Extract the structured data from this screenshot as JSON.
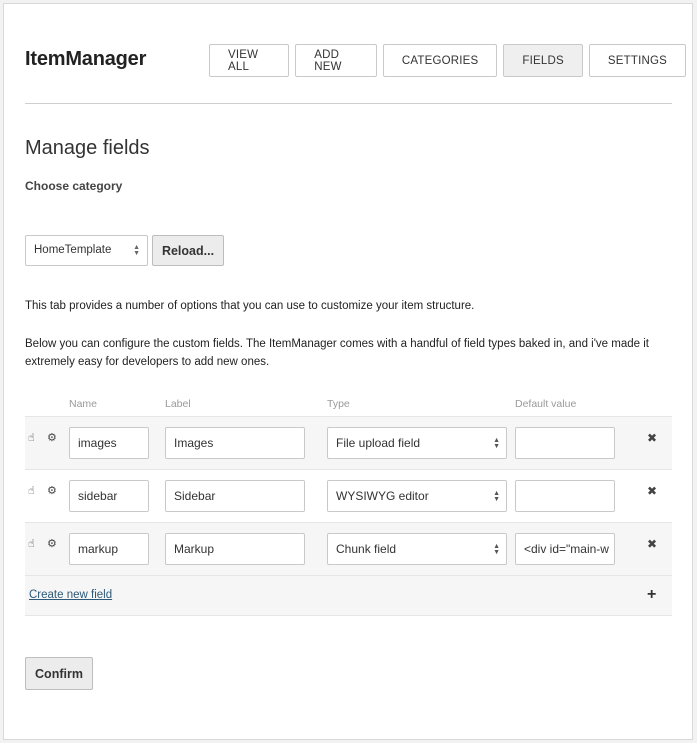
{
  "header": {
    "brand": "ItemManager",
    "nav": [
      {
        "label": "VIEW ALL",
        "active": false
      },
      {
        "label": "ADD NEW",
        "active": false
      },
      {
        "label": "CATEGORIES",
        "active": false
      },
      {
        "label": "FIELDS",
        "active": true
      },
      {
        "label": "SETTINGS",
        "active": false
      }
    ]
  },
  "main": {
    "title": "Manage fields",
    "choose_category_label": "Choose category",
    "category_select_value": "HomeTemplate",
    "reload_label": "Reload...",
    "intro_text": "This tab provides a number of options that you can use to customize your item structure.",
    "config_text": "Below you can configure the custom fields. The ItemManager comes with a handful of field types baked in, and i've made it extremely easy for developers to add new ones.",
    "columns": [
      "Name",
      "Label",
      "Type",
      "Default value"
    ],
    "fields": [
      {
        "name": "images",
        "label": "Images",
        "type": "File upload field",
        "default": ""
      },
      {
        "name": "sidebar",
        "label": "Sidebar",
        "type": "WYSIWYG editor",
        "default": ""
      },
      {
        "name": "markup",
        "label": "Markup",
        "type": "Chunk field",
        "default": "<div id=\"main-w"
      }
    ],
    "create_new_field_label": "Create new field",
    "confirm_label": "Confirm"
  },
  "icons": {
    "drag": "hand-pointer-icon",
    "settings": "gears-icon",
    "remove": "close-icon",
    "add": "plus-icon"
  }
}
